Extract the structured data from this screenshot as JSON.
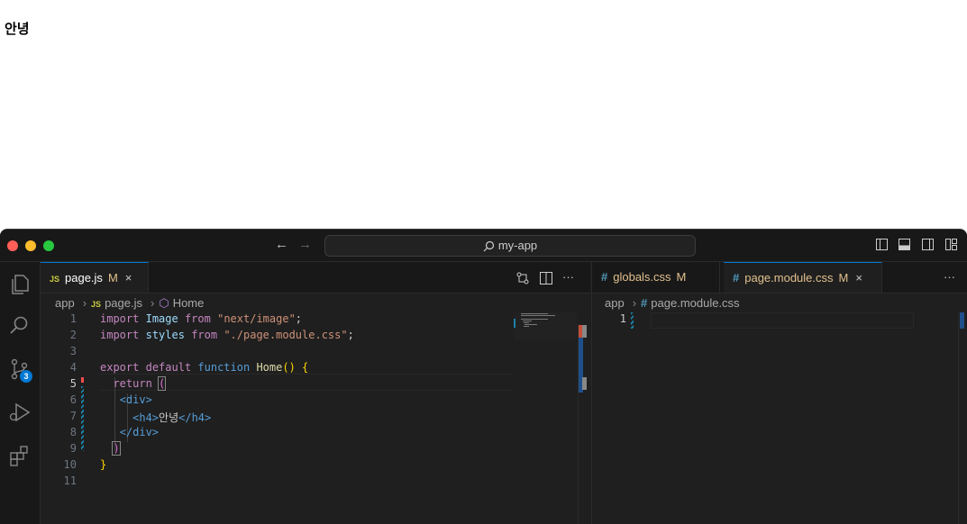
{
  "browser": {
    "heading": "안녕"
  },
  "titlebar": {
    "back_icon": "arrow-left-icon",
    "forward_icon": "arrow-right-icon",
    "search_text": "my-app",
    "traffic": {
      "close": "#ff5f57",
      "minimize": "#febc2e",
      "zoom": "#28c840"
    }
  },
  "activity": {
    "scm_badge": "3"
  },
  "editor1": {
    "tab": {
      "icon": "JS",
      "label": "page.js",
      "status": "M",
      "close": "×"
    },
    "actions": {
      "more": "···"
    },
    "breadcrumb": {
      "folder": "app",
      "file_icon": "JS",
      "file": "page.js",
      "symbol": "Home"
    },
    "line_numbers": [
      "1",
      "2",
      "3",
      "4",
      "5",
      "6",
      "7",
      "8",
      "9",
      "10",
      "11"
    ],
    "current_line": "5"
  },
  "editor2": {
    "tabs": [
      {
        "icon": "#",
        "label": "globals.css",
        "status": "M"
      },
      {
        "icon": "#",
        "label": "page.module.css",
        "status": "M",
        "close": "×"
      }
    ],
    "more": "···",
    "breadcrumb": {
      "folder": "app",
      "file_icon": "#",
      "file": "page.module.css"
    },
    "line_numbers": [
      "1"
    ]
  },
  "colors": {
    "accent": "#0078d4",
    "modified": "#e2c08d"
  }
}
